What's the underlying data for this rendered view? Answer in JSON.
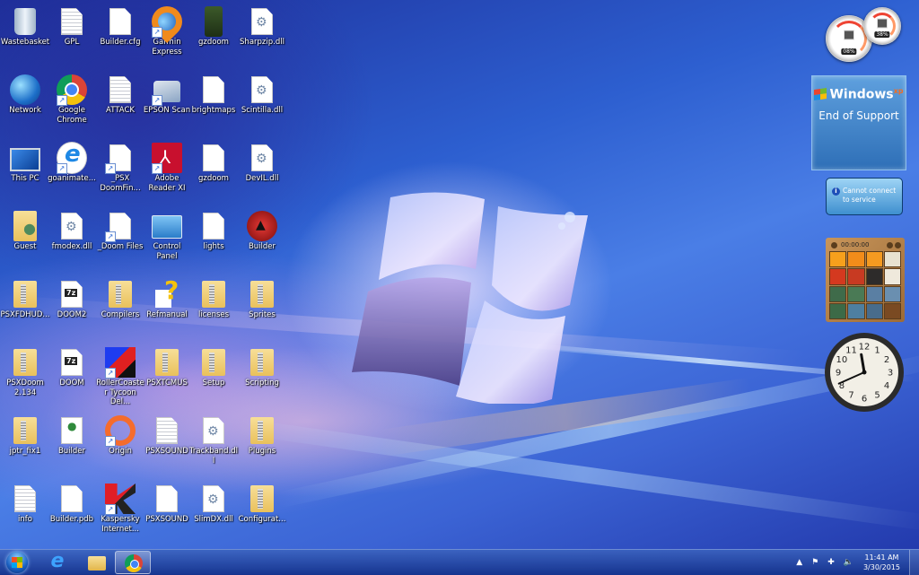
{
  "desktop": {
    "icons": [
      {
        "label": "Wastebasket",
        "type": "trash",
        "shortcut": false
      },
      {
        "label": "Network",
        "type": "globe",
        "shortcut": false
      },
      {
        "label": "This PC",
        "type": "pc",
        "shortcut": false
      },
      {
        "label": "Guest",
        "type": "guest",
        "shortcut": false
      },
      {
        "label": "PSXFDHUD...",
        "type": "folder",
        "shortcut": false
      },
      {
        "label": "PSXDoom 2.134",
        "type": "folder",
        "shortcut": false
      },
      {
        "label": "jptr_fix1",
        "type": "folder",
        "shortcut": false
      },
      {
        "label": "info",
        "type": "txt",
        "shortcut": false
      },
      {
        "label": "GPL",
        "type": "txt",
        "shortcut": false
      },
      {
        "label": "Google Chrome",
        "type": "chrome",
        "shortcut": true
      },
      {
        "label": "goanimate...",
        "type": "ie",
        "shortcut": true
      },
      {
        "label": "fmodex.dll",
        "type": "dll",
        "shortcut": false
      },
      {
        "label": "DOOM2",
        "type": "7z",
        "shortcut": false
      },
      {
        "label": "DOOM",
        "type": "7z",
        "shortcut": false
      },
      {
        "label": "Builder",
        "type": "html",
        "shortcut": false
      },
      {
        "label": "Builder.pdb",
        "type": "doc",
        "shortcut": false
      },
      {
        "label": "Builder.cfg",
        "type": "doc",
        "shortcut": false
      },
      {
        "label": "ATTACK",
        "type": "txt",
        "shortcut": false
      },
      {
        "label": "_PSX DoomFin...",
        "type": "doc",
        "shortcut": true
      },
      {
        "label": "_Doom Files",
        "type": "doc",
        "shortcut": true
      },
      {
        "label": "Compilers",
        "type": "folder",
        "shortcut": false
      },
      {
        "label": "RollerCoaster Tycoon Del...",
        "type": "rct",
        "shortcut": true
      },
      {
        "label": "Origin",
        "type": "origin",
        "shortcut": true
      },
      {
        "label": "Kaspersky Internet...",
        "type": "kaspersky",
        "shortcut": true
      },
      {
        "label": "Garmin Express",
        "type": "garmin",
        "shortcut": true
      },
      {
        "label": "EPSON Scan",
        "type": "epson",
        "shortcut": true
      },
      {
        "label": "Adobe Reader XI",
        "type": "adobe",
        "shortcut": true
      },
      {
        "label": "Control Panel",
        "type": "cpanel",
        "shortcut": false
      },
      {
        "label": "Refmanual",
        "type": "help",
        "shortcut": false
      },
      {
        "label": "PSXTCMUS",
        "type": "folder",
        "shortcut": false
      },
      {
        "label": "PSXSOUND",
        "type": "txt",
        "shortcut": false
      },
      {
        "label": "PSXSOUND",
        "type": "doc",
        "shortcut": false
      },
      {
        "label": "gzdoom",
        "type": "doom",
        "shortcut": false
      },
      {
        "label": "brightmaps",
        "type": "doc",
        "shortcut": false
      },
      {
        "label": "gzdoom",
        "type": "doc",
        "shortcut": false
      },
      {
        "label": "lights",
        "type": "doc",
        "shortcut": false
      },
      {
        "label": "licenses",
        "type": "folder",
        "shortcut": false
      },
      {
        "label": "Setup",
        "type": "folder",
        "shortcut": false
      },
      {
        "label": "Trackband.dll",
        "type": "dll",
        "shortcut": false
      },
      {
        "label": "SlimDX.dll",
        "type": "dll",
        "shortcut": false
      },
      {
        "label": "Sharpzip.dll",
        "type": "dll",
        "shortcut": false
      },
      {
        "label": "Scintilla.dll",
        "type": "dll",
        "shortcut": false
      },
      {
        "label": "DevIL.dll",
        "type": "dll",
        "shortcut": false
      },
      {
        "label": "Builder",
        "type": "builder",
        "shortcut": false
      },
      {
        "label": "Sprites",
        "type": "folder",
        "shortcut": false
      },
      {
        "label": "Scripting",
        "type": "folder",
        "shortcut": false
      },
      {
        "label": "Plugins",
        "type": "folder",
        "shortcut": false
      },
      {
        "label": "Configurat...",
        "type": "folder",
        "shortcut": false
      }
    ]
  },
  "gadgets": {
    "cpu_meter": {
      "cpu_readout": "08%",
      "memory_readout": "38%"
    },
    "xp_notice": {
      "brand": "Windows",
      "brand_suffix": "xp",
      "message": "End of Support"
    },
    "weather": {
      "status": "Cannot connect to service"
    },
    "puzzle": {
      "timer": "00:00:00"
    },
    "clock": {
      "hour": 11,
      "minute": 41,
      "numerals": [
        "12",
        "1",
        "2",
        "3",
        "4",
        "5",
        "6",
        "7",
        "8",
        "9",
        "10",
        "11"
      ]
    }
  },
  "taskbar": {
    "pinned": [
      {
        "name": "Internet Explorer",
        "active": false
      },
      {
        "name": "Windows Explorer",
        "active": false
      },
      {
        "name": "Google Chrome",
        "active": true
      }
    ],
    "tray": {
      "show_hidden_icon": "▲",
      "action_center_icon": "⚑",
      "network_icon": "✚",
      "volume_icon": "🔈"
    },
    "time": "11:41 AM",
    "date": "3/30/2015"
  },
  "colors": {
    "taskbar": "#1a3a9c",
    "wallpaper_top": "#1d2f9a",
    "wallpaper_mid": "#4a7ee6",
    "puzzle_frame": "#b5824a"
  }
}
